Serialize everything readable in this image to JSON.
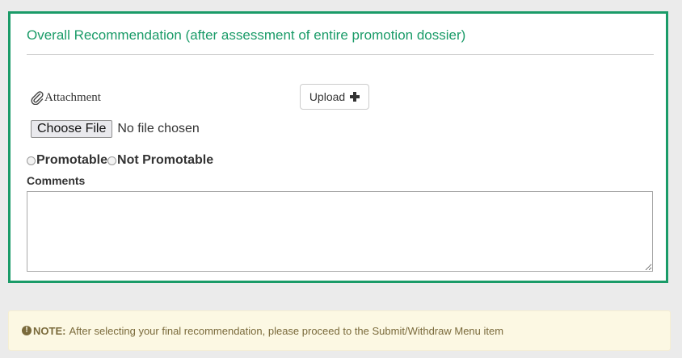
{
  "panel": {
    "title": "Overall Recommendation (after assessment of entire promotion dossier)",
    "accent_color": "#1a9b68"
  },
  "attachment": {
    "label": "Attachment",
    "icon": "paperclip-icon",
    "upload_label": "Upload",
    "upload_icon": "plus-icon",
    "choose_file_label": "Choose File",
    "no_file_text": "No file chosen"
  },
  "recommendation": {
    "options": [
      {
        "label": "Promotable",
        "selected": false
      },
      {
        "label": "Not Promotable",
        "selected": false
      }
    ]
  },
  "comments": {
    "label": "Comments",
    "value": ""
  },
  "note": {
    "icon": "info-circle-icon",
    "label": "NOTE:",
    "text": "After selecting your final recommendation, please proceed to the Submit/Withdraw Menu item",
    "background_color": "#fcf8e3"
  }
}
